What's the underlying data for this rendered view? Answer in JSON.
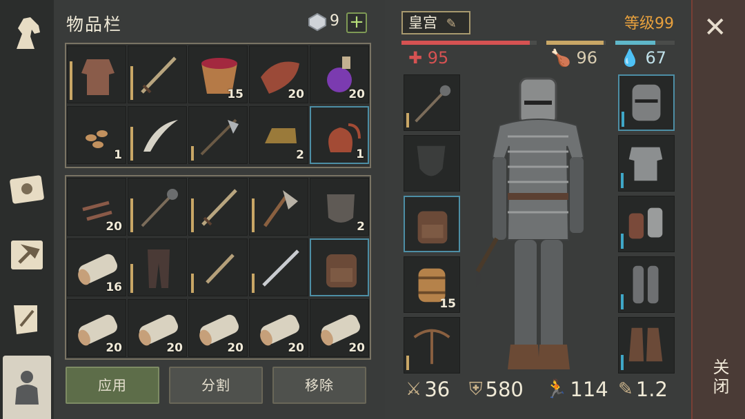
{
  "inventory": {
    "title": "物品栏",
    "currency_count": "9",
    "add_label": "+",
    "buttons": {
      "apply": "应用",
      "split": "分割",
      "remove": "移除"
    },
    "top_grid": [
      {
        "item": "chainmail-shirt",
        "count": "",
        "durability": 0.8
      },
      {
        "item": "sword",
        "count": "",
        "durability": 0.7
      },
      {
        "item": "berry-bucket",
        "count": "15"
      },
      {
        "item": "raw-meat",
        "count": "20"
      },
      {
        "item": "potion-flask",
        "count": "20"
      },
      {
        "item": "seeds",
        "count": "1"
      },
      {
        "item": "scimitar",
        "count": "",
        "durability": 0.7
      },
      {
        "item": "halberd",
        "count": "",
        "durability": 0.3
      },
      {
        "item": "ingot",
        "count": "2"
      },
      {
        "item": "red-bag",
        "count": "1",
        "highlighted": true
      }
    ],
    "bottom_grid": [
      {
        "item": "nails",
        "count": "20"
      },
      {
        "item": "mace",
        "count": "",
        "durability": 0.7
      },
      {
        "item": "sword",
        "count": "",
        "durability": 0.7
      },
      {
        "item": "axe",
        "count": "",
        "durability": 0.7
      },
      {
        "item": "iron-plate",
        "count": "2"
      },
      {
        "item": "birch-log",
        "count": "16"
      },
      {
        "item": "leather-pants",
        "count": "",
        "durability": 0.6
      },
      {
        "item": "short-sword",
        "count": "",
        "durability": 0.4
      },
      {
        "item": "long-sword",
        "count": "",
        "durability": 0.4
      },
      {
        "item": "backpack",
        "count": "",
        "highlighted": true
      },
      {
        "item": "birch-log",
        "count": "20"
      },
      {
        "item": "birch-log",
        "count": "20"
      },
      {
        "item": "birch-log",
        "count": "20"
      },
      {
        "item": "birch-log",
        "count": "20"
      },
      {
        "item": "birch-log",
        "count": "20"
      }
    ]
  },
  "character": {
    "title": "皇宫",
    "level": "等级99",
    "health": "95",
    "food": "96",
    "water": "67",
    "health_pct": 0.95,
    "food_pct": 0.96,
    "water_pct": 0.67,
    "colors": {
      "health": "#d65252",
      "food": "#c9a766",
      "water": "#5fb7c9",
      "level": "#e8a13d"
    },
    "left_slots": [
      {
        "item": "mace",
        "count": "",
        "durability": 0.3
      },
      {
        "item": "shield-placeholder",
        "count": ""
      },
      {
        "item": "backpack",
        "count": "",
        "highlighted": true
      },
      {
        "item": "barrel",
        "count": "15"
      },
      {
        "item": "crossbow",
        "count": "",
        "durability": 0.3
      }
    ],
    "right_slots": [
      {
        "item": "great-helm",
        "highlighted": true
      },
      {
        "item": "scale-armor"
      },
      {
        "item": "plate-gauntlets"
      },
      {
        "item": "greaves"
      },
      {
        "item": "boots"
      }
    ],
    "stats": {
      "attack": "36",
      "armor": "580",
      "speed": "114",
      "weight": "1.2"
    }
  },
  "close_label": "关闭",
  "nav": [
    "horse-icon",
    "journal-icon",
    "crafting-icon",
    "scroll-icon",
    "character-icon"
  ]
}
